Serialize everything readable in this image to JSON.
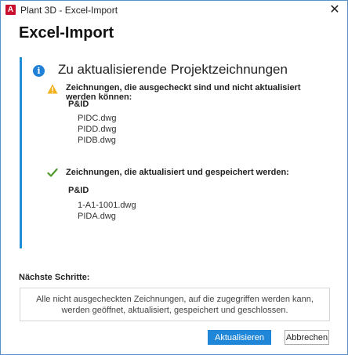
{
  "window": {
    "title": "Plant 3D - Excel-Import",
    "app_icon_letter": "A",
    "close_glyph": "✕"
  },
  "heading": "Excel-Import",
  "panel": {
    "title": "Zu aktualisierende Projektzeichnungen",
    "info_icon_glyph": "i",
    "warning_section": {
      "label": "Zeichnungen, die ausgecheckt sind und nicht aktualisiert werden können:",
      "group": "P&ID",
      "files": [
        "PIDC.dwg",
        "PIDD.dwg",
        "PIDB.dwg"
      ]
    },
    "success_section": {
      "label": "Zeichnungen, die aktualisiert und gespeichert werden:",
      "group": "P&ID",
      "files": [
        "1-A1-1001.dwg",
        "PIDA.dwg"
      ]
    }
  },
  "next_steps": {
    "label": "Nächste Schritte:",
    "line1": "Alle nicht ausgecheckten Zeichnungen, auf die zugegriffen werden kann,",
    "line2": "werden geöffnet, aktualisiert, gespeichert und geschlossen."
  },
  "buttons": {
    "update": "Aktualisieren",
    "cancel": "Abbrechen"
  },
  "colors": {
    "accent": "#1e8ed8",
    "primary_button": "#1f86d8",
    "app_icon": "#c8102e",
    "warning": "#f2b21b",
    "success": "#4e9a2e"
  }
}
